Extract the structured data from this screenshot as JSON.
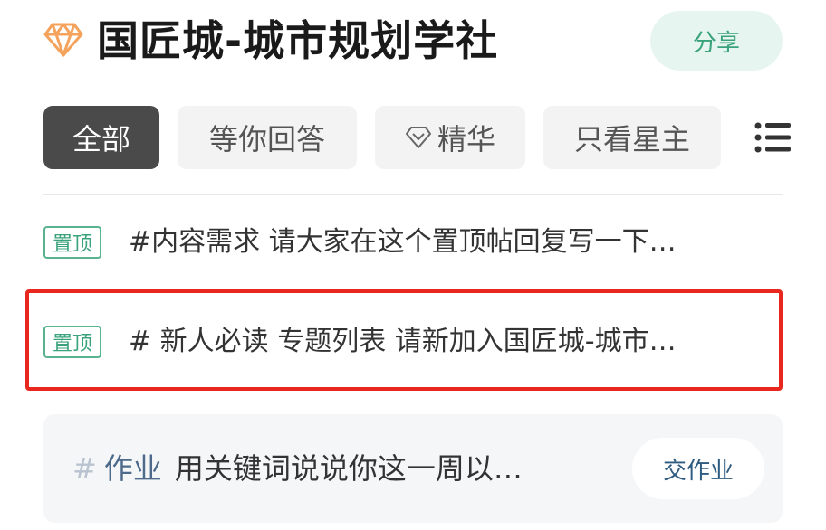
{
  "header": {
    "title": "国匠城-城市规划学社",
    "share_label": "分享",
    "colors": {
      "accent_orange": "#f4a25c",
      "share_bg": "#e6f5ef",
      "share_text": "#3aa37c"
    }
  },
  "tabs": [
    {
      "label": "全部",
      "active": true
    },
    {
      "label": "等你回答",
      "active": false
    },
    {
      "label": "精华",
      "active": false,
      "icon": "diamond-icon"
    },
    {
      "label": "只看星主",
      "active": false
    }
  ],
  "menu_icon": "list-menu-icon",
  "pinned_posts": [
    {
      "badge": "置顶",
      "text": "#内容需求 请大家在这个置顶帖回复写一下…"
    },
    {
      "badge": "置顶",
      "text": "# 新人必读 专题列表 请新加入国匠城-城市…"
    }
  ],
  "homework": {
    "hash": "#",
    "tag": "作业",
    "text": "用关键词说说你这一周以…",
    "button_label": "交作业"
  },
  "highlight_color": "#e8281e"
}
